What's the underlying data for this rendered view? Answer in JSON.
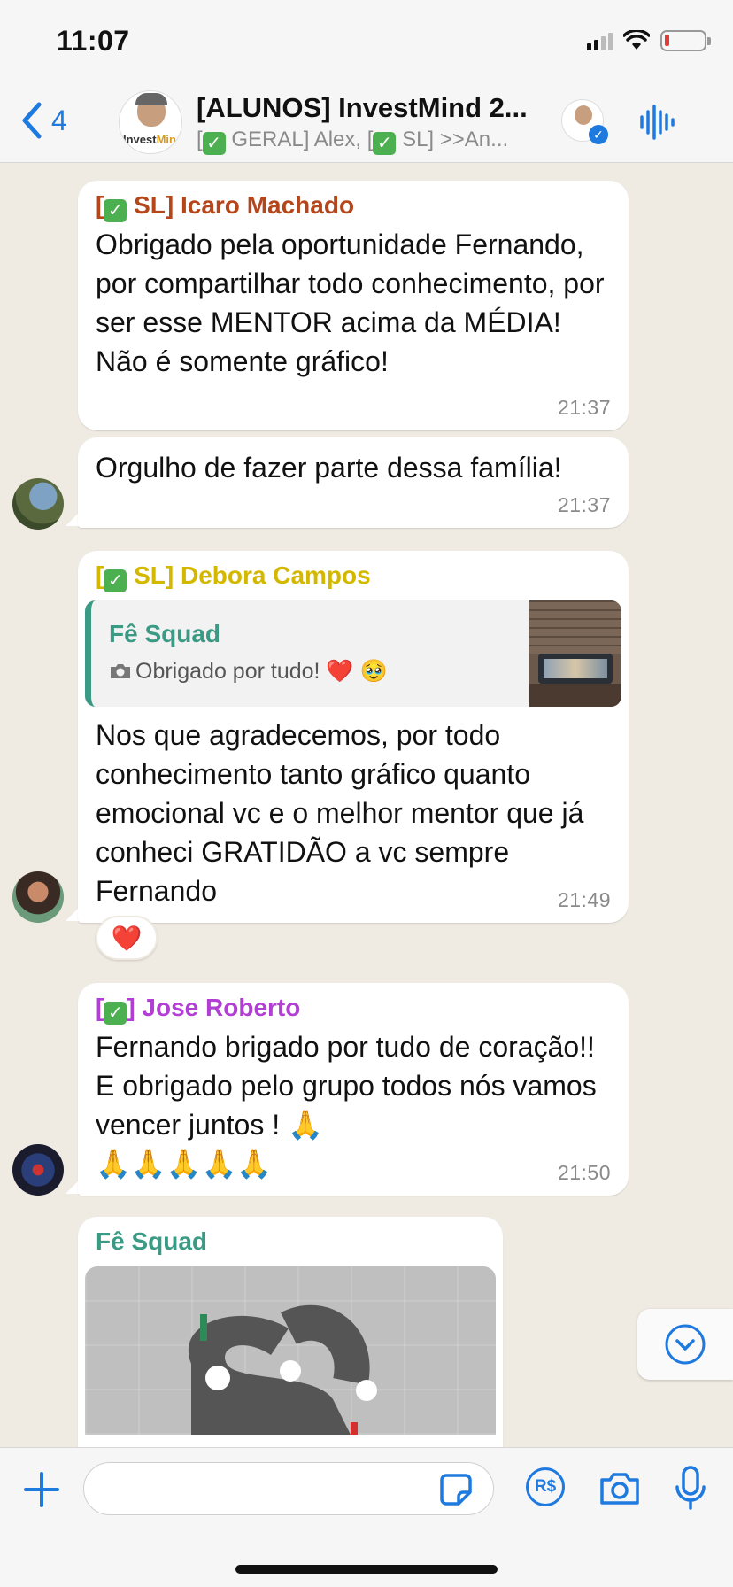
{
  "status_bar": {
    "time": "11:07"
  },
  "header": {
    "back_count": "4",
    "title": "[ALUNOS] InvestMind 2...",
    "subtitle_part1": "[",
    "subtitle_part2": " GERAL] Alex, [",
    "subtitle_part3": " SL] >>An...",
    "group_avatar_brand_1": "Invest",
    "group_avatar_brand_2": "Mind",
    "check_glyph": "✓",
    "badge_glyph": "✓"
  },
  "messages": [
    {
      "sender_prefix": "[",
      "sender_rest": " SL] Icaro Machado",
      "sender_color": "#b5451b",
      "text": "Obrigado pela oportunidade Fernando, por compartilhar todo conhecimento, por ser esse MENTOR acima da MÉDIA!\nNão é somente gráfico!",
      "time": "21:37"
    },
    {
      "text": "Orgulho de fazer parte dessa família!",
      "time": "21:37"
    },
    {
      "sender_prefix": "[",
      "sender_rest": " SL] Debora Campos",
      "sender_color": "#d4b800",
      "quote_name": "Fê Squad",
      "quote_text": "Obrigado por tudo! ❤️ 🥹",
      "quote_icon": "camera-icon",
      "text": "Nos que agradecemos, por todo conhecimento tanto gráfico quanto emocional vc e o melhor mentor que já conheci GRATIDÃO a vc sempre Fernando",
      "time": "21:49",
      "reaction": "❤️"
    },
    {
      "sender_prefix": "[",
      "sender_rest": "] Jose Roberto",
      "sender_color": "#b23fd4",
      "text": "Fernando brigado por tudo de coração!! E obrigado pelo grupo todos nós vamos vencer juntos ! 🙏\n🙏🙏🙏🙏🙏",
      "time": "21:50"
    },
    {
      "sender": "Fê Squad",
      "sender_color": "#3a9a83"
    }
  ],
  "input": {
    "placeholder": ""
  },
  "icons": {
    "back": "chevron-left-icon",
    "audio": "waveform-icon",
    "plus": "plus-icon",
    "sticker": "sticker-icon",
    "pix": "currency-real-icon",
    "pix_label": "R$",
    "camera": "camera-icon",
    "mic": "microphone-icon",
    "scroll": "chevron-down-icon"
  },
  "colors": {
    "accent_blue": "#1f7ae0",
    "chat_background": "#efeae2",
    "bubble": "#ffffff",
    "check_green": "#4caf50"
  }
}
